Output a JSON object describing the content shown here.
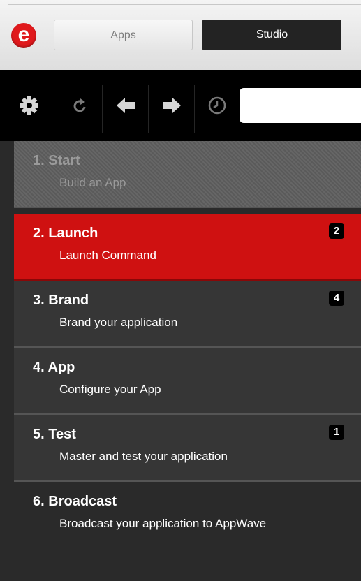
{
  "header": {
    "logo_letter": "e",
    "tabs": [
      {
        "label": "Apps"
      },
      {
        "label": "Studio"
      }
    ]
  },
  "toolbar": {
    "icons": [
      "gear-icon",
      "refresh-icon",
      "back-arrow-icon",
      "forward-arrow-icon",
      "history-clock-icon"
    ],
    "search": {
      "value": "",
      "placeholder": ""
    }
  },
  "steps": [
    {
      "number": "1.",
      "title": "Start",
      "subtitle": "Build an App",
      "badge": "",
      "state": "disabled"
    },
    {
      "number": "2.",
      "title": "Launch",
      "subtitle": "Launch Command",
      "badge": "2",
      "state": "active"
    },
    {
      "number": "3.",
      "title": "Brand",
      "subtitle": "Brand your application",
      "badge": "4",
      "state": "normal"
    },
    {
      "number": "4.",
      "title": "App",
      "subtitle": "Configure your App",
      "badge": "",
      "state": "normal"
    },
    {
      "number": "5.",
      "title": "Test",
      "subtitle": "Master and test your application",
      "badge": "1",
      "state": "normal"
    },
    {
      "number": "6.",
      "title": "Broadcast",
      "subtitle": "Broadcast your application to AppWave",
      "badge": "",
      "state": "normal"
    }
  ],
  "colors": {
    "active": "#cf1111",
    "panel": "#363636",
    "toolbar": "#000000",
    "logo": "#e0191c"
  }
}
